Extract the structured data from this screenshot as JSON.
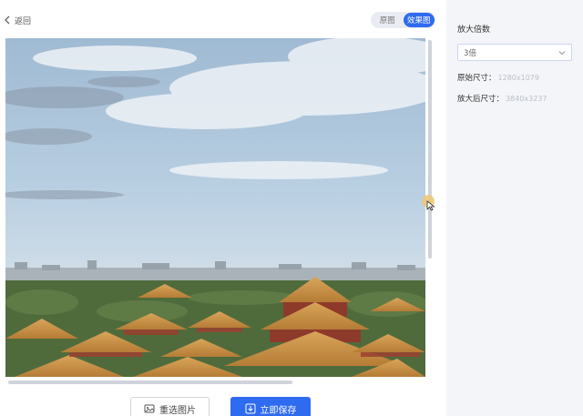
{
  "header": {
    "back_label": "返回",
    "toggle": {
      "original_label": "原图",
      "result_label": "效果图",
      "active": "result"
    }
  },
  "viewer": {
    "image": "forbidden-city-skyline-photo"
  },
  "actions": {
    "reselect_label": "重选图片",
    "save_label": "立即保存"
  },
  "panel": {
    "scale_title": "放大倍数",
    "scale_value": "3倍",
    "original_size_label": "原始尺寸：",
    "original_size_value": "1280x1079",
    "enlarged_size_label": "放大后尺寸：",
    "enlarged_size_value": "3840x3237"
  },
  "colors": {
    "accent": "#2f6bf0",
    "panel_bg": "#f4f5f8"
  }
}
